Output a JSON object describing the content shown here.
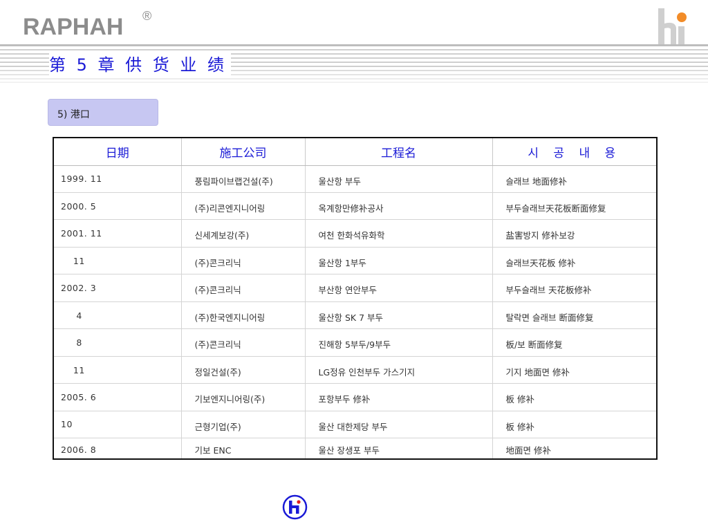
{
  "header": {
    "brand": "RAPHAH",
    "registered": "®",
    "title": "第 5 章  供 货 业 绩"
  },
  "section": {
    "label": "5) 港口"
  },
  "table": {
    "headers": [
      "日期",
      "施工公司",
      "工程名",
      "시 공 내 용"
    ],
    "rows": [
      [
        "1999. 11",
        "풍림파이브랩건설(주)",
        "울산항 부두",
        "슬래브 地面修补"
      ],
      [
        "2000. 5",
        "(주)리콘엔지니어링",
        "옥계항만修补공사",
        "부두슬래브天花板断面修复"
      ],
      [
        "2001. 11",
        "신세계보강(주)",
        "여천 한화석유화학",
        "盐害방지 修补보강"
      ],
      [
        "    11",
        "(주)콘크리닉",
        "울산항 1부두",
        "슬래브天花板 修补"
      ],
      [
        "2002. 3",
        "(주)콘크리닉",
        "부산항 연안부두",
        "부두슬래브 天花板修补"
      ],
      [
        "     4",
        "(주)한국엔지니어링",
        "울산항 SK 7 부두",
        "탈락면 슬래브 断面修复"
      ],
      [
        "     8",
        "(주)콘크리닉",
        "진해항 5부두/9부두",
        "板/보 断面修复"
      ],
      [
        "    11",
        "정일건설(주)",
        "LG정유 인천부두 가스기지",
        "기지 地面면 修补"
      ],
      [
        "2005. 6",
        "기보엔지니어링(주)",
        "포항부두 修补",
        "板 修补"
      ],
      [
        "10",
        "근형기업(주)",
        "울산 대한제당 부두",
        "板 修补"
      ],
      [
        "2006. 8",
        "기보 ENC",
        "울산 장생포 부두",
        "地面면 修补"
      ]
    ]
  },
  "colors": {
    "title_blue": "#1a1ad6",
    "brand_gray": "#8c8c8c",
    "tab_fill": "#c7c7f2",
    "logo_orange": "#f28c28",
    "logo_blue": "#1a1ad6",
    "logo_red": "#e02020"
  },
  "icons": {
    "top_logo": "hi-logo-icon",
    "bottom_logo": "hi-round-logo-icon"
  }
}
